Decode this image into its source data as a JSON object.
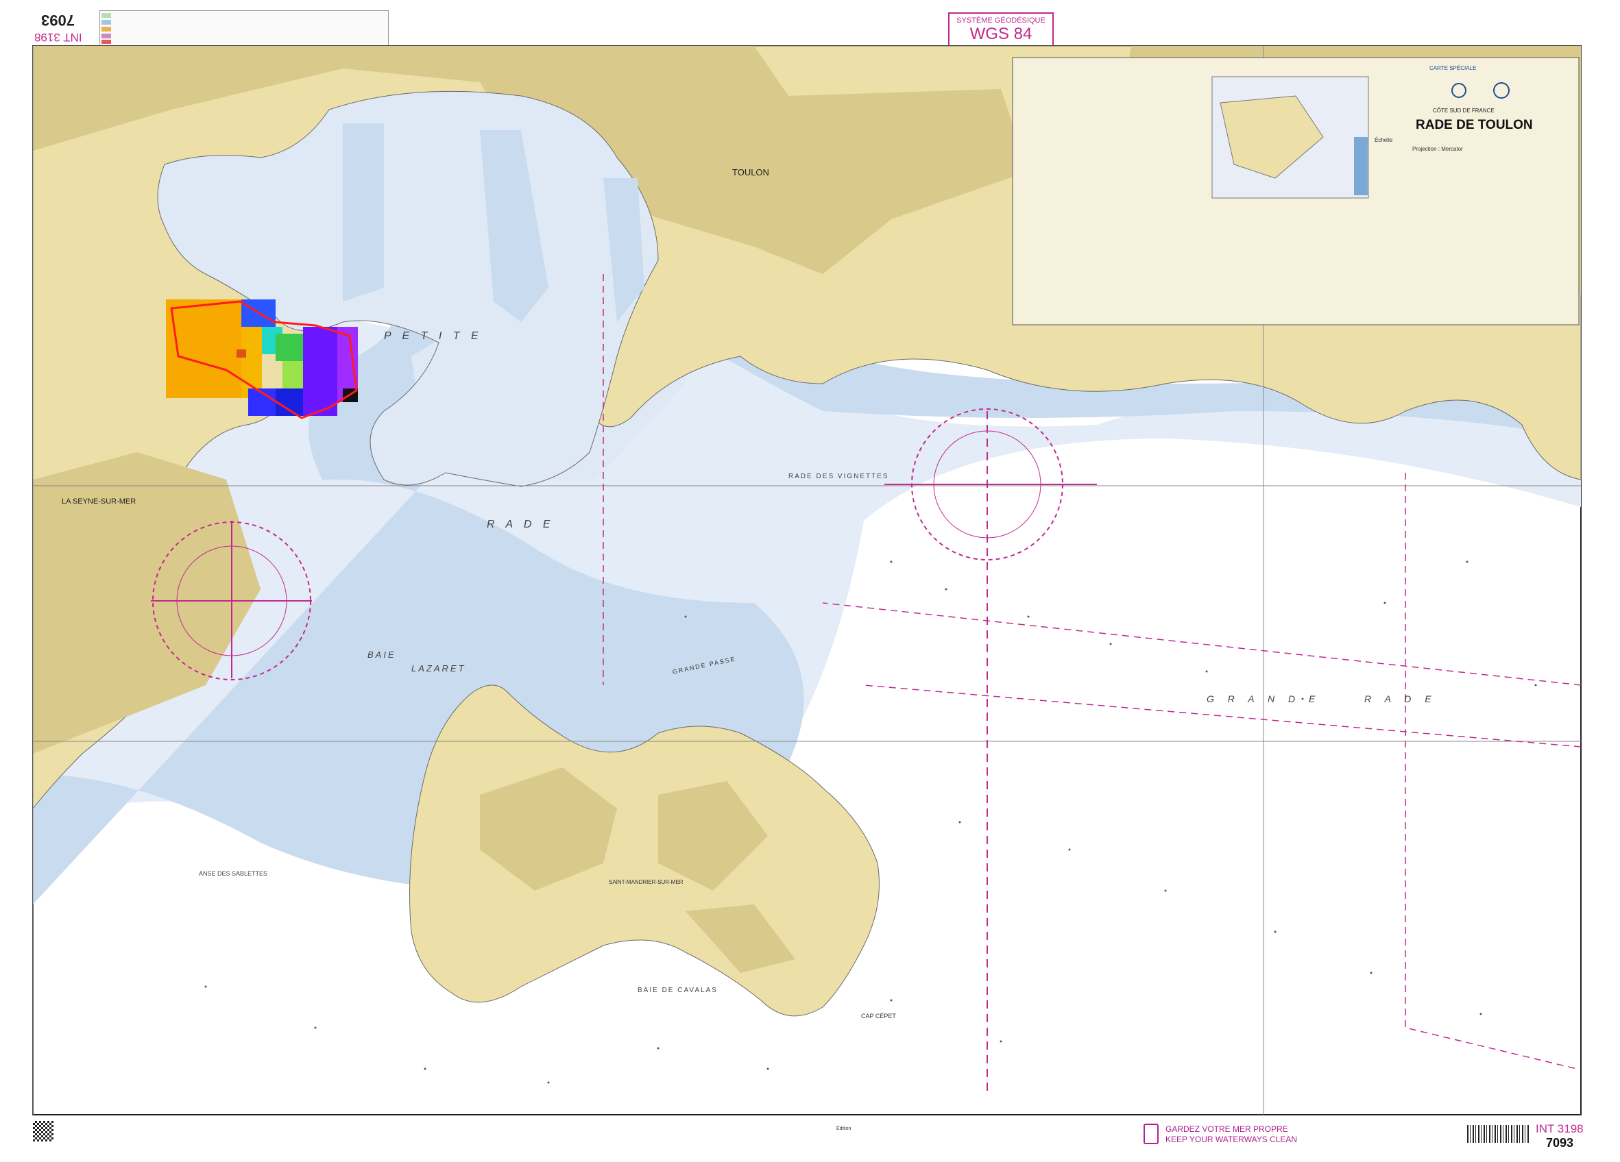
{
  "header": {
    "chart_number_inverted": "7093",
    "int_number_inverted": "INT 3198",
    "datum_label": "SYSTÈME GÉODÉSIQUE",
    "datum_value": "WGS 84"
  },
  "cartouche": {
    "series": "CARTE SPÉCIALE",
    "region": "CÔTE SUD DE FRANCE",
    "title": "RADE DE TOULON",
    "scale": "Échelle",
    "projection": "Projection : Mercator"
  },
  "places": {
    "toulon": "TOULON",
    "la_seyne": "LA SEYNE-SUR-MER",
    "petite": "P E T I T E",
    "rade": "R A D E",
    "grande": "G R A N D E",
    "grande_rade": "R A D E",
    "rade_des_vignettes": "RADE DES VIGNETTES",
    "baie_lazaret": "LAZARET",
    "baie_seyne": "BAIE",
    "anse": "ANSE DES SABLETTES",
    "baie_cavalas": "BAIE DE CAVALAS",
    "cap_cepet": "CAP CÉPET",
    "grande_passe": "GRANDE PASSE",
    "st_mandrier": "SAINT-MANDRIER-SUR-MER"
  },
  "footer": {
    "slogan_fr": "GARDEZ VOTRE MER PROPRE",
    "slogan_en": "KEEP YOUR WATERWAYS CLEAN",
    "int_number": "INT 3198",
    "chart_number": "7093",
    "edition": "Édition"
  },
  "colors": {
    "land": "#ecdfa8",
    "land_dark": "#d9c98a",
    "shallow": "#a9c5e4",
    "mid": "#cddcef",
    "deep": "#ffffff",
    "magenta": "#b0218f"
  }
}
